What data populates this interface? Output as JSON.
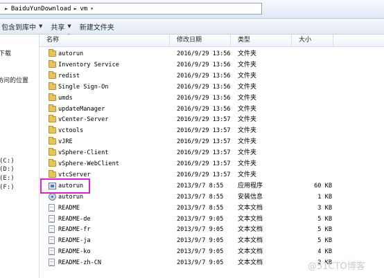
{
  "address": {
    "segments": [
      "BaiduYunDownload",
      "vm"
    ],
    "separator": "►"
  },
  "toolbar": {
    "include_label": "包含到库中",
    "share_label": "共享",
    "new_folder_label": "新建文件夹"
  },
  "nav": {
    "downloads_partial": "下载",
    "recent_partial": "访问的位置",
    "drive_c": "(C:)",
    "drive_d": "(D:)",
    "drive_e": "(E:)",
    "drive_f": "(F:)"
  },
  "columns": {
    "name": "名称",
    "date": "修改日期",
    "type": "类型",
    "size": "大小"
  },
  "files": [
    {
      "name": "autorun",
      "date": "2016/9/29 13:56",
      "type": "文件夹",
      "size": "",
      "icon": "folder-icon"
    },
    {
      "name": "Inventory Service",
      "date": "2016/9/29 13:56",
      "type": "文件夹",
      "size": "",
      "icon": "folder-icon"
    },
    {
      "name": "redist",
      "date": "2016/9/29 13:56",
      "type": "文件夹",
      "size": "",
      "icon": "folder-icon"
    },
    {
      "name": "Single Sign-On",
      "date": "2016/9/29 13:56",
      "type": "文件夹",
      "size": "",
      "icon": "folder-icon"
    },
    {
      "name": "umds",
      "date": "2016/9/29 13:56",
      "type": "文件夹",
      "size": "",
      "icon": "folder-icon"
    },
    {
      "name": "updateManager",
      "date": "2016/9/29 13:56",
      "type": "文件夹",
      "size": "",
      "icon": "folder-icon"
    },
    {
      "name": "vCenter-Server",
      "date": "2016/9/29 13:57",
      "type": "文件夹",
      "size": "",
      "icon": "folder-icon"
    },
    {
      "name": "vctools",
      "date": "2016/9/29 13:57",
      "type": "文件夹",
      "size": "",
      "icon": "folder-icon"
    },
    {
      "name": "vJRE",
      "date": "2016/9/29 13:57",
      "type": "文件夹",
      "size": "",
      "icon": "folder-icon"
    },
    {
      "name": "vSphere-Client",
      "date": "2016/9/29 13:57",
      "type": "文件夹",
      "size": "",
      "icon": "folder-icon"
    },
    {
      "name": "vSphere-WebClient",
      "date": "2016/9/29 13:57",
      "type": "文件夹",
      "size": "",
      "icon": "folder-icon"
    },
    {
      "name": "vtcServer",
      "date": "2016/9/29 13:57",
      "type": "文件夹",
      "size": "",
      "icon": "folder-icon"
    },
    {
      "name": "autorun",
      "date": "2013/9/7 8:55",
      "type": "应用程序",
      "size": "60 KB",
      "icon": "application-icon"
    },
    {
      "name": "autorun",
      "date": "2013/9/7 8:55",
      "type": "安装信息",
      "size": "1 KB",
      "icon": "setup-info-icon"
    },
    {
      "name": "README",
      "date": "2013/9/7 8:55",
      "type": "文本文档",
      "size": "3 KB",
      "icon": "text-document-icon"
    },
    {
      "name": "README-de",
      "date": "2013/9/7 9:05",
      "type": "文本文档",
      "size": "5 KB",
      "icon": "text-document-icon"
    },
    {
      "name": "README-fr",
      "date": "2013/9/7 9:05",
      "type": "文本文档",
      "size": "5 KB",
      "icon": "text-document-icon"
    },
    {
      "name": "README-ja",
      "date": "2013/9/7 9:05",
      "type": "文本文档",
      "size": "5 KB",
      "icon": "text-document-icon"
    },
    {
      "name": "README-ko",
      "date": "2013/9/7 9:05",
      "type": "文本文档",
      "size": "4 KB",
      "icon": "text-document-icon"
    },
    {
      "name": "README-zh-CN",
      "date": "2013/9/7 9:05",
      "type": "文本文档",
      "size": "2 KB",
      "icon": "text-document-icon"
    }
  ],
  "watermark": "@51CTO博客",
  "colors": {
    "highlight_border": "#e020d8",
    "folder": "#e8c45a"
  }
}
